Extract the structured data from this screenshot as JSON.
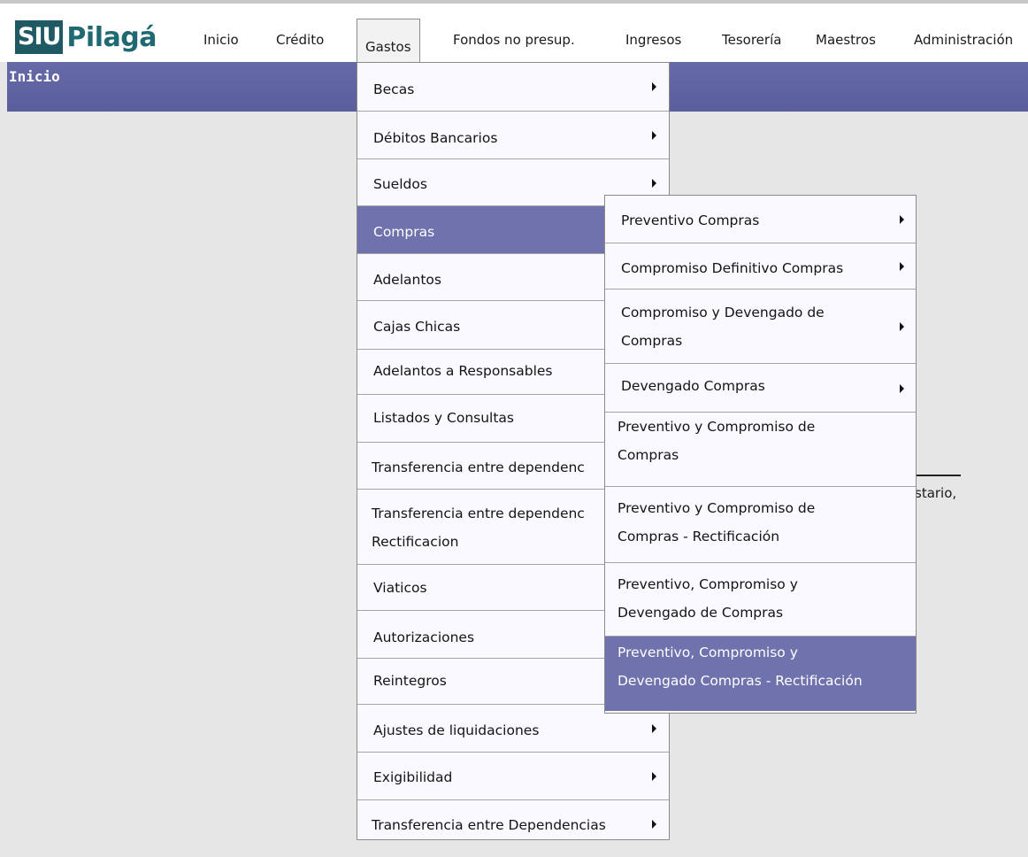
{
  "logo": {
    "box": "SIU",
    "text": "Pilagá"
  },
  "nav": [
    "Inicio",
    "Crédito",
    "Gastos",
    "Fondos no presup.",
    "Ingresos",
    "Tesorería",
    "Maestros",
    "Administración"
  ],
  "page_title": "Inicio",
  "background_fragment": "stario,",
  "gastos_menu": [
    {
      "label": "Becas",
      "arrow": true
    },
    {
      "label": "Débitos Bancarios",
      "arrow": true
    },
    {
      "label": "Sueldos",
      "arrow": true
    },
    {
      "label": "Compras",
      "arrow": true,
      "selected": true
    },
    {
      "label": "Adelantos",
      "arrow": true
    },
    {
      "label": "Cajas Chicas",
      "arrow": true
    },
    {
      "label": "Adelantos a Responsables",
      "arrow": true
    },
    {
      "label": "Listados y Consultas",
      "arrow": true
    },
    {
      "label": "Transferencia entre dependenc",
      "arrow": false
    },
    {
      "label": "Transferencia entre dependenc\nRectificacion",
      "arrow": false
    },
    {
      "label": "Viaticos",
      "arrow": true
    },
    {
      "label": "Autorizaciones",
      "arrow": true
    },
    {
      "label": "Reintegros",
      "arrow": true
    },
    {
      "label": "Ajustes de liquidaciones",
      "arrow": true
    },
    {
      "label": "Exigibilidad",
      "arrow": true
    },
    {
      "label": "Transferencia entre Dependencias",
      "arrow": true
    }
  ],
  "compras_menu": [
    {
      "label": "Preventivo Compras",
      "arrow": true
    },
    {
      "label": "Compromiso Definitivo Compras",
      "arrow": true
    },
    {
      "label": "Compromiso y Devengado de\nCompras",
      "arrow": true
    },
    {
      "label": "Devengado Compras",
      "arrow": true
    },
    {
      "label": "Preventivo y Compromiso de\nCompras",
      "arrow": false
    },
    {
      "label": "Preventivo y Compromiso de\nCompras - Rectificación",
      "arrow": false
    },
    {
      "label": "Preventivo, Compromiso y\nDevengado de Compras",
      "arrow": false
    },
    {
      "label": "Preventivo, Compromiso y\nDevengado Compras - Rectificación",
      "arrow": false,
      "selected": true
    }
  ]
}
